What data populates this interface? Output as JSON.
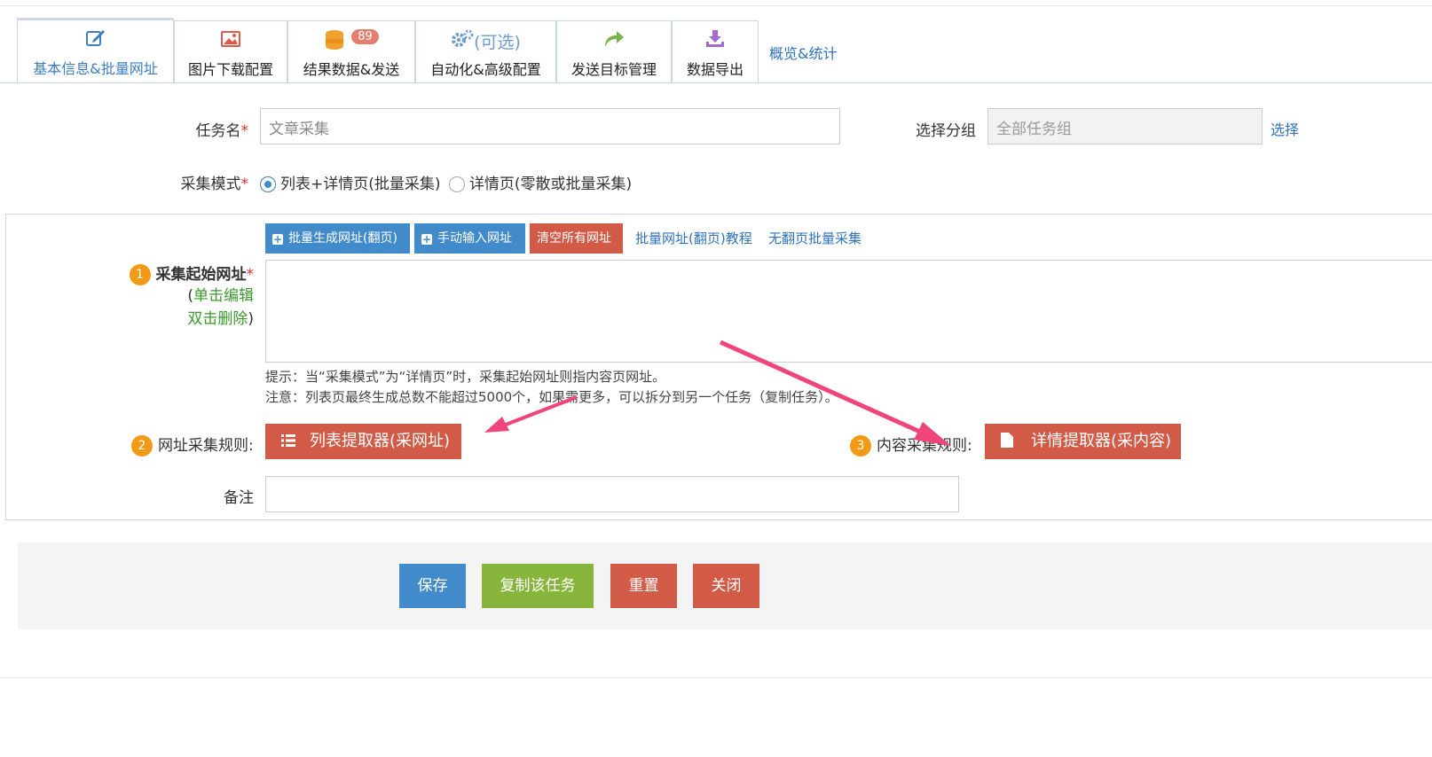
{
  "tabs": [
    {
      "label": "基本信息&批量网址",
      "icon": "edit-icon"
    },
    {
      "label": "图片下载配置",
      "icon": "image-icon"
    },
    {
      "label": "结果数据&发送",
      "icon": "database-icon",
      "badge": "89"
    },
    {
      "label": "自动化&高级配置",
      "icon": "gears-icon",
      "extra": "(可选)"
    },
    {
      "label": "发送目标管理",
      "icon": "share-arrow-icon"
    },
    {
      "label": "数据导出",
      "icon": "download-icon"
    }
  ],
  "overview_link": "概览&统计",
  "task_name": {
    "label": "任务名",
    "required": "*",
    "value": "文章采集"
  },
  "group": {
    "label": "选择分组",
    "value": "全部任务组",
    "select_link": "选择"
  },
  "mode": {
    "label": "采集模式",
    "required": "*",
    "options": [
      "列表+详情页(批量采集)",
      "详情页(零散或批量采集)"
    ],
    "selected": 0
  },
  "url_buttons": {
    "batch": "批量生成网址(翻页)",
    "manual": "手动输入网址",
    "clear": "清空所有网址",
    "tutorial_link": "批量网址(翻页)教程",
    "no_page_link": "无翻页批量采集"
  },
  "start_url": {
    "num": "1",
    "label": "采集起始网址",
    "required": "*",
    "paren_open": "(",
    "hint1": "单击编辑",
    "hint2": "双击删除",
    "paren_close": ")"
  },
  "tips": {
    "line1": "提示：当“采集模式”为“详情页”时，采集起始网址则指内容页网址。",
    "line2": "注意：列表页最终生成总数不能超过5000个，如果需更多，可以拆分到另一个任务（复制任务）。"
  },
  "url_rule": {
    "num": "2",
    "label": "网址采集规则:",
    "button": "列表提取器(采网址)"
  },
  "content_rule": {
    "num": "3",
    "label": "内容采集规则:",
    "button": "详情提取器(采内容)"
  },
  "remark": {
    "label": "备注",
    "value": ""
  },
  "footer": {
    "save": "保存",
    "copy": "复制该任务",
    "reset": "重置",
    "close": "关闭"
  },
  "colors": {
    "primary": "#428bca",
    "danger": "#d15b47",
    "success": "#87b53b",
    "accent": "#f29a16",
    "arrow": "#f0457a"
  }
}
